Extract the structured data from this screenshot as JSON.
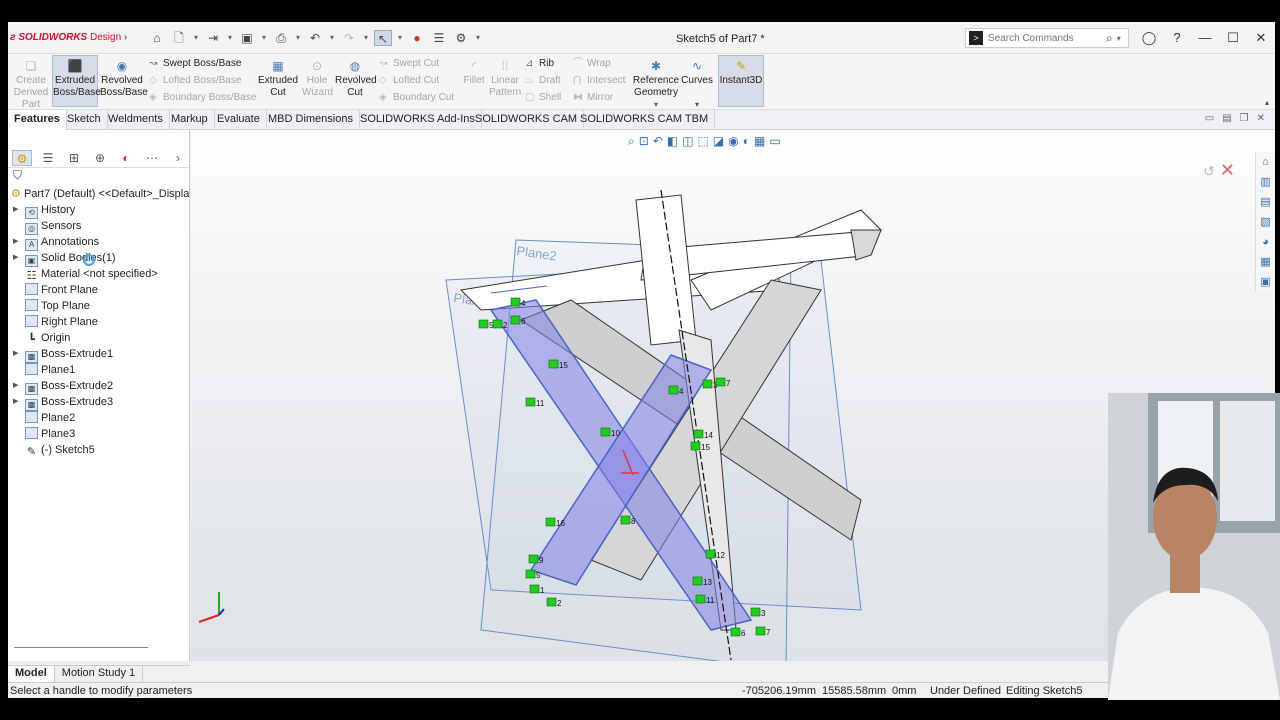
{
  "titlebar": {
    "logo": "SOLIDWORKS",
    "logo_sub": "Design",
    "document_title": "Sketch5 of Part7 *",
    "search_placeholder": "Search Commands"
  },
  "ribbon": {
    "big_buttons": [
      {
        "label": "Create Derived Part",
        "enabled": false,
        "icon": "derived-part-icon"
      },
      {
        "label": "Extruded Boss/Base",
        "enabled": true,
        "icon": "extrude-icon"
      },
      {
        "label": "Revolved Boss/Base",
        "enabled": true,
        "icon": "revolve-icon"
      },
      {
        "label": "Extruded Cut",
        "enabled": true,
        "icon": "extrude-cut-icon"
      },
      {
        "label": "Hole Wizard",
        "enabled": false,
        "icon": "hole-icon"
      },
      {
        "label": "Revolved Cut",
        "enabled": true,
        "icon": "revolve-cut-icon"
      },
      {
        "label": "Fillet",
        "enabled": false,
        "icon": "fillet-icon"
      },
      {
        "label": "Linear Pattern",
        "enabled": false,
        "icon": "pattern-icon"
      },
      {
        "label": "Reference Geometry",
        "enabled": true,
        "icon": "reference-icon"
      },
      {
        "label": "Curves",
        "enabled": true,
        "icon": "curves-icon"
      },
      {
        "label": "Instant3D",
        "enabled": true,
        "icon": "instant3d-icon"
      }
    ],
    "stack_boss": [
      {
        "label": "Swept Boss/Base",
        "enabled": true
      },
      {
        "label": "Lofted Boss/Base",
        "enabled": false
      },
      {
        "label": "Boundary Boss/Base",
        "enabled": false
      }
    ],
    "stack_cut": [
      {
        "label": "Swept Cut",
        "enabled": false
      },
      {
        "label": "Lofted Cut",
        "enabled": false
      },
      {
        "label": "Boundary Cut",
        "enabled": false
      }
    ],
    "stack_features": [
      {
        "label": "Rib",
        "enabled": true
      },
      {
        "label": "Draft",
        "enabled": false
      },
      {
        "label": "Shell",
        "enabled": false
      }
    ],
    "stack_more": [
      {
        "label": "Wrap",
        "enabled": false
      },
      {
        "label": "Intersect",
        "enabled": false
      },
      {
        "label": "Mirror",
        "enabled": false
      }
    ]
  },
  "tabs": [
    "Features",
    "Sketch",
    "Weldments",
    "Markup",
    "Evaluate",
    "MBD Dimensions",
    "SOLIDWORKS Add-Ins",
    "SOLIDWORKS CAM",
    "SOLIDWORKS CAM TBM"
  ],
  "tree": {
    "root": "Part7 (Default) <<Default>_Display S",
    "items": [
      {
        "label": "History",
        "expand": true,
        "icon": "history-icon"
      },
      {
        "label": "Sensors",
        "expand": false,
        "icon": "sensor-icon"
      },
      {
        "label": "Annotations",
        "expand": true,
        "icon": "annotation-icon"
      },
      {
        "label": "Solid Bodies(1)",
        "expand": true,
        "icon": "solid-bodies-icon"
      },
      {
        "label": "Material <not specified>",
        "expand": false,
        "icon": "material-icon"
      },
      {
        "label": "Front Plane",
        "expand": false,
        "icon": "plane-icon"
      },
      {
        "label": "Top Plane",
        "expand": false,
        "icon": "plane-icon"
      },
      {
        "label": "Right Plane",
        "expand": false,
        "icon": "plane-icon"
      },
      {
        "label": "Origin",
        "expand": false,
        "icon": "origin-icon"
      },
      {
        "label": "Boss-Extrude1",
        "expand": true,
        "icon": "extrude-feature-icon"
      },
      {
        "label": "Plane1",
        "expand": false,
        "icon": "plane-icon"
      },
      {
        "label": "Boss-Extrude2",
        "expand": true,
        "icon": "extrude-feature-icon"
      },
      {
        "label": "Boss-Extrude3",
        "expand": true,
        "icon": "extrude-feature-icon"
      },
      {
        "label": "Plane2",
        "expand": false,
        "icon": "plane-icon"
      },
      {
        "label": "Plane3",
        "expand": false,
        "icon": "plane-icon"
      },
      {
        "label": "(-) Sketch5",
        "expand": false,
        "icon": "sketch-icon"
      }
    ]
  },
  "viewport": {
    "plane_labels": [
      "Plane2",
      "Plane3"
    ],
    "relation_labels": [
      "4",
      "5",
      "6",
      "2",
      "15",
      "11",
      "10",
      "4",
      "3",
      "7",
      "14",
      "15",
      "16",
      "9",
      "5",
      "1",
      "2",
      "8",
      "12",
      "11",
      "13",
      "3",
      "7",
      "6"
    ]
  },
  "bottom_tabs": [
    "Model",
    "Motion Study 1"
  ],
  "status": {
    "message": "Select a handle to modify parameters",
    "x": "-705206.19mm",
    "y": "15585.58mm",
    "z": "0mm",
    "state": "Under Defined",
    "mode": "Editing Sketch5"
  },
  "colors": {
    "accent": "#3a6ea8",
    "sketch_fill": "#8c8ce6",
    "relation_green": "#22cc22",
    "logo_red": "#c8102e"
  }
}
